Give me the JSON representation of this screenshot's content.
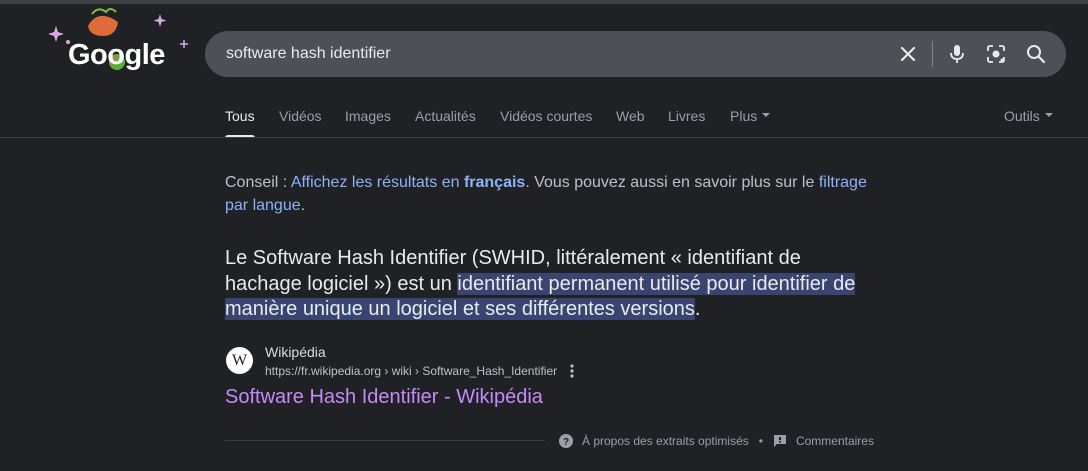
{
  "logo": {
    "text": "Google"
  },
  "search": {
    "query": "software hash identifier"
  },
  "tabs": [
    {
      "label": "Tous"
    },
    {
      "label": "Vidéos"
    },
    {
      "label": "Images"
    },
    {
      "label": "Actualités"
    },
    {
      "label": "Vidéos courtes"
    },
    {
      "label": "Web"
    },
    {
      "label": "Livres"
    },
    {
      "label": "Plus"
    }
  ],
  "tools": {
    "label": "Outils"
  },
  "tip": {
    "prefix": "Conseil : ",
    "link1": "Affichez les résultats en ",
    "link1_bold": "français",
    "middle": ". Vous pouvez aussi en savoir plus sur le ",
    "link2": "filtrage par langue",
    "suffix": "."
  },
  "snippet": {
    "plain": "Le Software Hash Identifier (SWHID, littéralement « identifiant de hachage logiciel ») est un ",
    "highlight": "identifiant permanent utilisé pour identifier de manière unique un logiciel et ses différentes versions",
    "end": "."
  },
  "source": {
    "favicon": "W",
    "name": "Wikipédia",
    "url": "https://fr.wikipedia.org › wiki › Software_Hash_Identifier",
    "title": "Software Hash Identifier - Wikipédia"
  },
  "footer": {
    "about": "À propos des extraits optimisés",
    "separator": "•",
    "feedback": "Commentaires"
  },
  "colors": {
    "background": "#202124",
    "link": "#8ab4f8",
    "visited": "#c58af9",
    "highlight": "#394570"
  },
  "icons": [
    "clear-icon",
    "mic-icon",
    "lens-icon",
    "search-icon",
    "more-vert-icon",
    "help-icon",
    "feedback-icon"
  ]
}
